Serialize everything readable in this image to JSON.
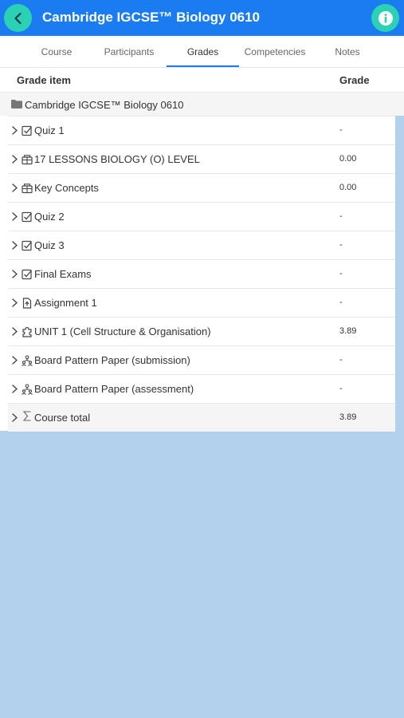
{
  "header": {
    "title": "Cambridge IGCSE™ Biology 0610",
    "back_icon": "chevron-left-icon",
    "info_icon": "info-icon",
    "accent": "#1a7cf0",
    "button_color": "#2bd1b5"
  },
  "tabs": [
    {
      "label": "Course"
    },
    {
      "label": "Participants"
    },
    {
      "label": "Grades",
      "active": true
    },
    {
      "label": "Competencies"
    },
    {
      "label": "Notes"
    }
  ],
  "table": {
    "col_item": "Grade item",
    "col_grade": "Grade",
    "category": "Cambridge IGCSE™ Biology 0610",
    "rows": [
      {
        "icon": "quiz-icon",
        "label": "Quiz 1",
        "grade": "-"
      },
      {
        "icon": "lesson-icon",
        "label": "17 LESSONS BIOLOGY (O) LEVEL",
        "grade": "0.00"
      },
      {
        "icon": "lesson-icon",
        "label": "Key Concepts",
        "grade": "0.00"
      },
      {
        "icon": "quiz-icon",
        "label": "Quiz 2",
        "grade": "-"
      },
      {
        "icon": "quiz-icon",
        "label": "Quiz 3",
        "grade": "-"
      },
      {
        "icon": "quiz-icon",
        "label": "Final Exams",
        "grade": "-"
      },
      {
        "icon": "assignment-icon",
        "label": "Assignment 1",
        "grade": "-"
      },
      {
        "icon": "puzzle-icon",
        "label": "UNIT 1 (Cell Structure & Organisation)",
        "grade": "3.89"
      },
      {
        "icon": "workshop-icon",
        "label": "Board Pattern Paper (submission)",
        "grade": "-"
      },
      {
        "icon": "workshop-icon",
        "label": "Board Pattern Paper (assessment)",
        "grade": "-"
      },
      {
        "icon": "sigma-icon",
        "label": "Course total",
        "grade": "3.89"
      }
    ]
  }
}
